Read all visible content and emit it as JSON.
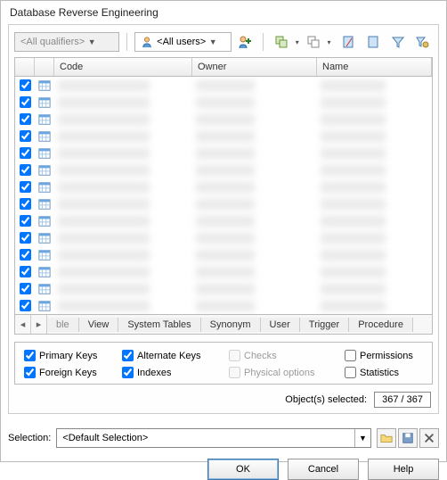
{
  "title": "Database Reverse Engineering",
  "toolbar": {
    "qualifier_combo": "<All qualifiers>",
    "user_combo": "<All users>"
  },
  "columns": {
    "code": "Code",
    "owner": "Owner",
    "name": "Name"
  },
  "rows": [
    {
      "checked": true
    },
    {
      "checked": true
    },
    {
      "checked": true
    },
    {
      "checked": true
    },
    {
      "checked": true
    },
    {
      "checked": true
    },
    {
      "checked": true
    },
    {
      "checked": true
    },
    {
      "checked": true
    },
    {
      "checked": true
    },
    {
      "checked": true
    },
    {
      "checked": true
    },
    {
      "checked": true
    },
    {
      "checked": true
    }
  ],
  "tabs": {
    "left_partial": "ble",
    "view": "View",
    "system": "System Tables",
    "synonym": "Synonym",
    "user": "User",
    "trigger": "Trigger",
    "procedure": "Procedure"
  },
  "options": {
    "primary_keys": {
      "label": "Primary Keys",
      "checked": true,
      "enabled": true
    },
    "foreign_keys": {
      "label": "Foreign Keys",
      "checked": true,
      "enabled": true
    },
    "alternate_keys": {
      "label": "Alternate Keys",
      "checked": true,
      "enabled": true
    },
    "indexes": {
      "label": "Indexes",
      "checked": true,
      "enabled": true
    },
    "checks": {
      "label": "Checks",
      "checked": false,
      "enabled": false
    },
    "physical_options": {
      "label": "Physical options",
      "checked": false,
      "enabled": false
    },
    "permissions": {
      "label": "Permissions",
      "checked": false,
      "enabled": true
    },
    "statistics": {
      "label": "Statistics",
      "checked": false,
      "enabled": true
    }
  },
  "objects_selected": {
    "label": "Object(s) selected:",
    "value": "367 / 367"
  },
  "selection": {
    "label": "Selection:",
    "value": "<Default Selection>"
  },
  "buttons": {
    "ok": "OK",
    "cancel": "Cancel",
    "help": "Help"
  }
}
